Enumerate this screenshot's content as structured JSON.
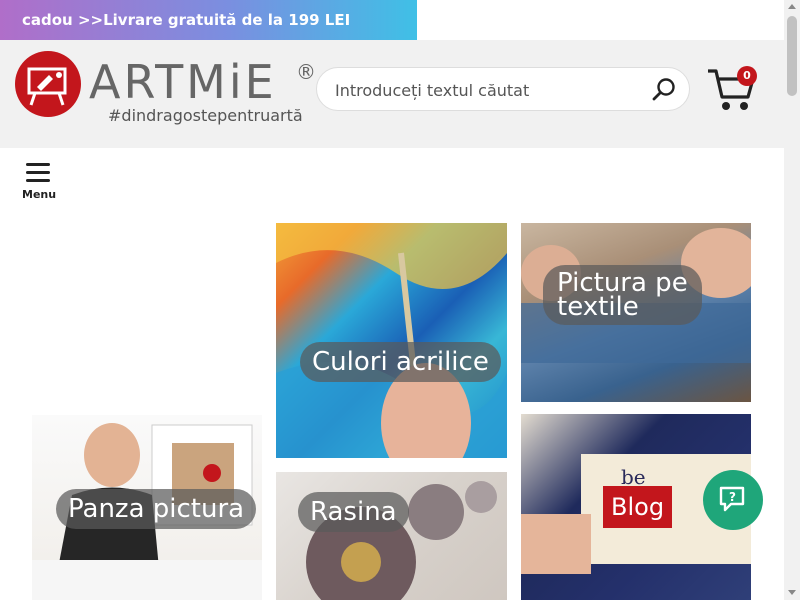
{
  "promo": {
    "text": "cadou  >>Livrare gratuită de la 199 LEI"
  },
  "brand": {
    "name": "ARTMiE",
    "registered": "®",
    "tagline": "#dindragostepentruartă",
    "accent": "#c3161c"
  },
  "search": {
    "placeholder": "Introduceți textul căutat"
  },
  "cart": {
    "count": "0"
  },
  "menu": {
    "label": "Menu"
  },
  "tiles": {
    "acrylic": "Culori acrilice",
    "textile_line1": "Pictura pe",
    "textile_line2": "textile",
    "canvas": "Panza pictura",
    "resin": "Rasina",
    "blog": "Blog"
  },
  "icons": {
    "search": "search-icon",
    "cart": "cart-icon",
    "menu": "hamburger-icon",
    "chat": "chat-help-icon",
    "logo": "easel-logo-icon"
  }
}
